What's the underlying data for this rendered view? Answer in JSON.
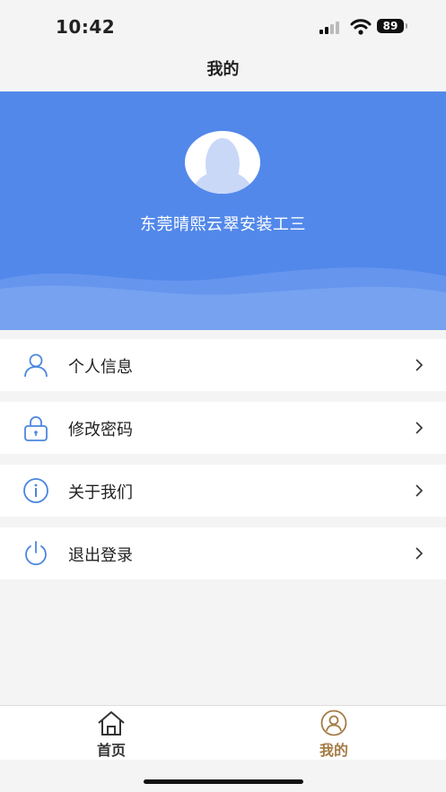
{
  "status_bar": {
    "time": "10:42",
    "battery": "89"
  },
  "nav": {
    "title": "我的"
  },
  "profile": {
    "name": "东莞晴熙云翠安装工三"
  },
  "menu": [
    {
      "label": "个人信息",
      "icon": "user-icon"
    },
    {
      "label": "修改密码",
      "icon": "lock-icon"
    },
    {
      "label": "关于我们",
      "icon": "info-icon"
    },
    {
      "label": "退出登录",
      "icon": "power-icon"
    }
  ],
  "tabs": [
    {
      "label": "首页",
      "icon": "home-icon",
      "active": false
    },
    {
      "label": "我的",
      "icon": "profile-icon",
      "active": true
    }
  ],
  "colors": {
    "accent": "#5288ea",
    "tab_active": "#a57b45",
    "icon_blue": "#4a86e0"
  }
}
